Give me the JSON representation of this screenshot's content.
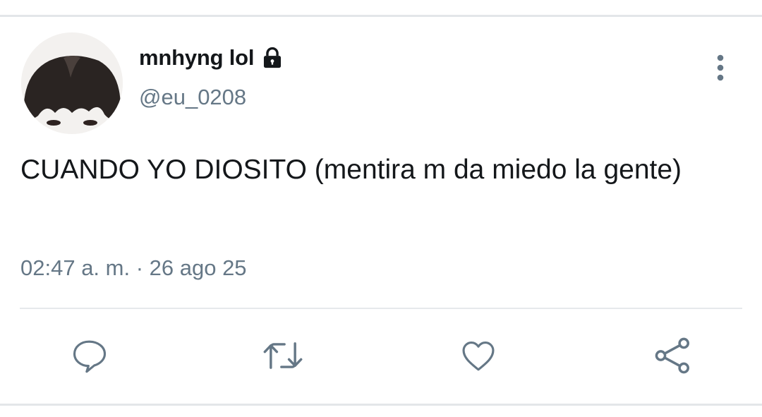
{
  "tweet": {
    "display_name": "mnhyng lol",
    "handle": "@eu_0208",
    "text": "CUANDO YO DIOSITO (mentira m da miedo la gente)",
    "timestamp": "02:47 a. m. · 26 ago 25",
    "protected": true
  },
  "icons": {
    "lock": "lock-icon",
    "more": "more-vertical-icon",
    "reply": "reply-icon",
    "retweet": "retweet-icon",
    "like": "heart-icon",
    "share": "share-icon"
  },
  "colors": {
    "text_primary": "#14171a",
    "text_secondary": "#657786",
    "icon": "#657786",
    "divider": "#e6e9ec"
  }
}
